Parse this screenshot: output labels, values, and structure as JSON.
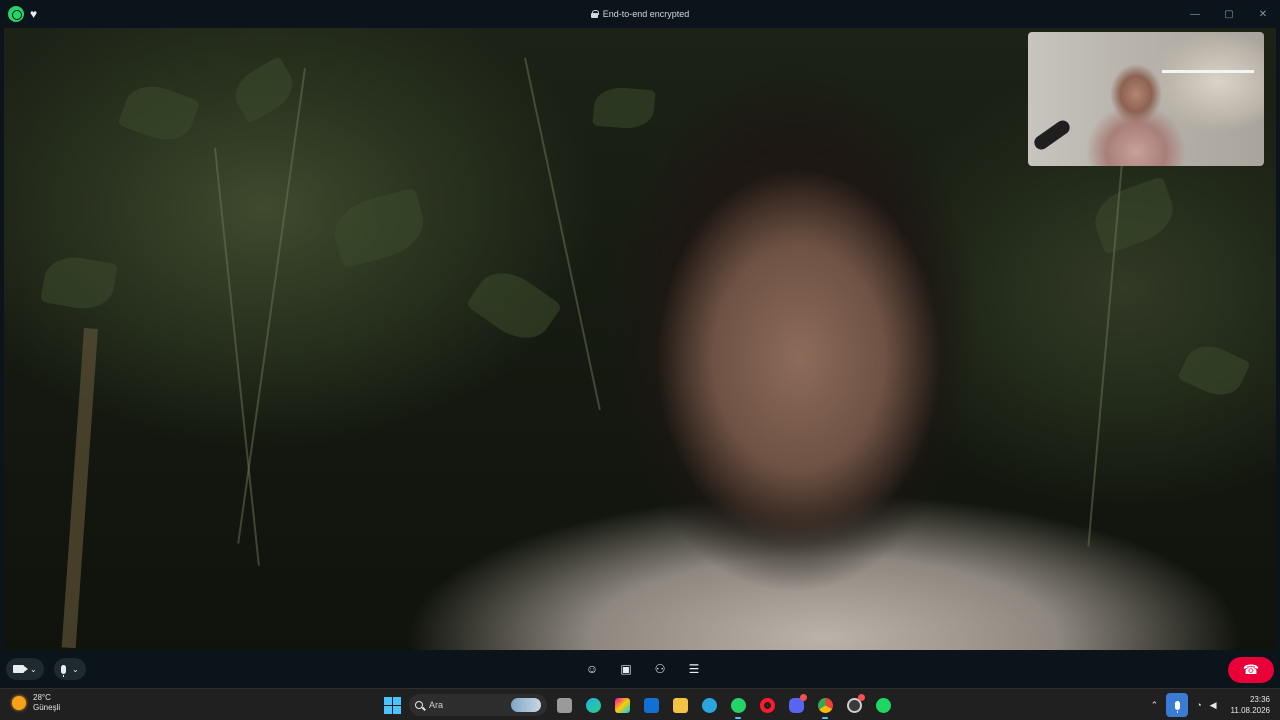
{
  "window": {
    "title": "End-to-end encrypted",
    "app_icon": "whatsapp-icon",
    "favorite_icon": "heart-icon",
    "controls": [
      "minimize-icon",
      "maximize-icon",
      "close-icon"
    ]
  },
  "call": {
    "main_video": "remote participant video",
    "self_view": "local camera preview",
    "left_controls": [
      "camera-icon",
      "chevron-down-icon",
      "microphone-icon",
      "chevron-down-icon"
    ],
    "center_controls": [
      "emoji-icon",
      "screen-share-icon",
      "add-participant-icon",
      "raise-hand-icon"
    ],
    "end_call_icon": "end-call-icon",
    "end_call_color": "#ea0038"
  },
  "taskbar": {
    "weather": {
      "temperature": "28°C",
      "condition": "Güneşli"
    },
    "search_placeholder": "Ara",
    "apps": [
      "windows-start-icon",
      "file-explorer-icon",
      "edge-browser-icon",
      "copilot-icon",
      "outlook-icon",
      "folder-icon",
      "telegram-icon",
      "whatsapp-icon",
      "opera-icon",
      "discord-icon",
      "chrome-icon",
      "settings-icon",
      "spotify-icon"
    ],
    "tray": {
      "time": "23:36",
      "date": "11.08.2026"
    }
  }
}
